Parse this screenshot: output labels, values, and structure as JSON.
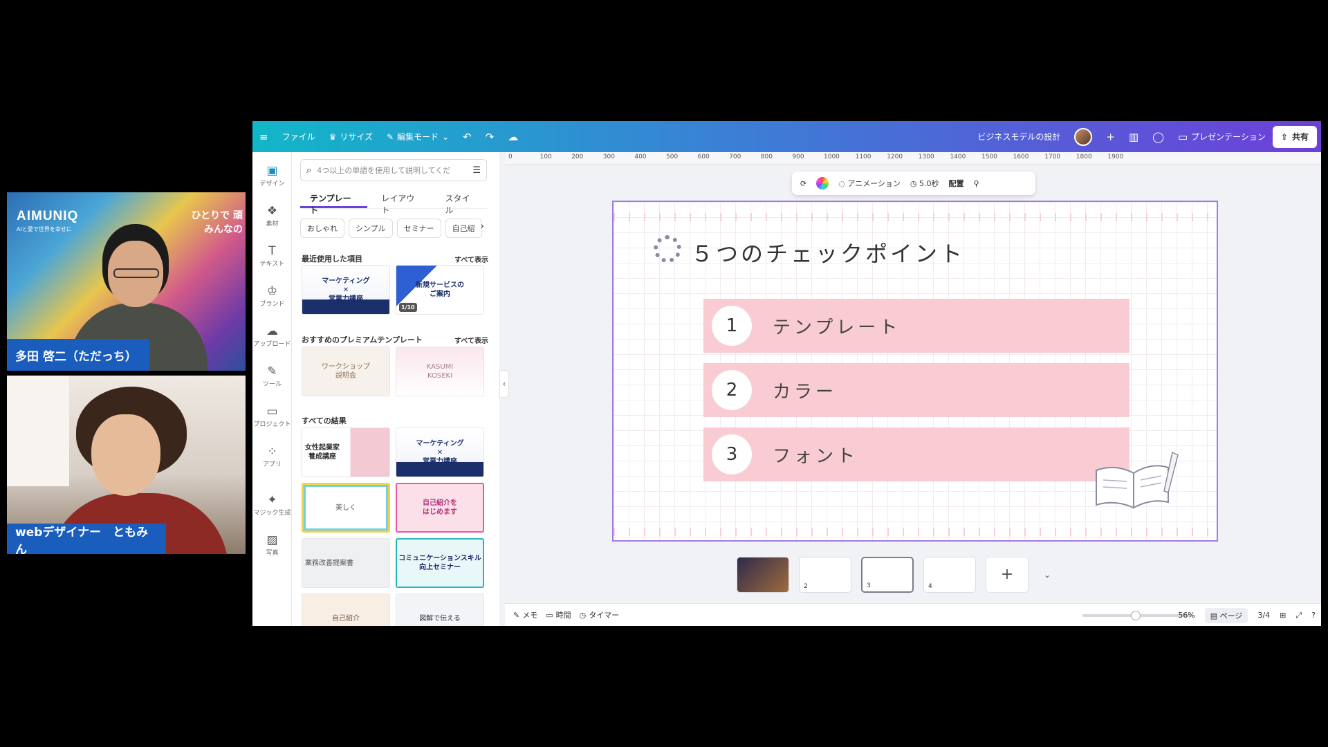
{
  "video1": {
    "logo": "AIMUNIQ",
    "logo_sub": "AIと愛で世界を幸せに",
    "banner": "ひとりで 頑\nみんなの",
    "name": "多田 啓二（ただっち）"
  },
  "video2": {
    "name": "webデザイナー　ともみん"
  },
  "topbar": {
    "menu_icon": "≡",
    "file": "ファイル",
    "resize": "リサイズ",
    "edit_mode": "編集モード",
    "undo": "↶",
    "redo": "↷",
    "cloud": "☁",
    "doc_title": "ビジネスモデルの設計",
    "plus": "+",
    "present": "プレゼンテーション",
    "share": "共有"
  },
  "rail": [
    {
      "icon": "▣",
      "label": "デザイン"
    },
    {
      "icon": "❖",
      "label": "素材"
    },
    {
      "icon": "T",
      "label": "テキスト"
    },
    {
      "icon": "♔",
      "label": "ブランド"
    },
    {
      "icon": "☁",
      "label": "アップロード"
    },
    {
      "icon": "✎",
      "label": "ツール"
    },
    {
      "icon": "▭",
      "label": "プロジェクト"
    },
    {
      "icon": "⁘",
      "label": "アプリ"
    },
    {
      "icon": "✦",
      "label": "マジック生成"
    },
    {
      "icon": "▨",
      "label": "写真"
    }
  ],
  "panel": {
    "search_placeholder": "4つ以上の単語を使用して説明してくだ",
    "tabs": [
      "テンプレート",
      "レイアウト",
      "スタイル"
    ],
    "chips": [
      "おしゃれ",
      "シンプル",
      "セミナー",
      "自己紹"
    ],
    "recent_title": "最近使用した項目",
    "see_all": "すべて表示",
    "premium_title": "おすすめのプレミアムテンプレート",
    "results_title": "すべての結果",
    "thumbs": {
      "mkt": "マーケティング\n✕\n営業力講座",
      "new": "新規サービスの\nご案内",
      "new_count": "1/10",
      "ws": "ワークショップ\n説明会",
      "kas": "KASUMI\nKOSEKI",
      "wom": "女性起業家\n養成講座",
      "mkt2": "マーケティング\n✕\n営業力講座",
      "beauty": "美しく",
      "pink": "自己紹介を\nはじめます",
      "gray": "業務改善提案書",
      "comm": "コミュニケーションスキル\n向上セミナー",
      "self": "自己紹介",
      "fig": "図解で伝える"
    }
  },
  "ruler": [
    "0",
    "100",
    "200",
    "300",
    "400",
    "500",
    "600",
    "700",
    "800",
    "900",
    "1000",
    "1100",
    "1200",
    "1300",
    "1400",
    "1500",
    "1600",
    "1700",
    "1800",
    "1900"
  ],
  "float_toolbar": {
    "animation": "アニメーション",
    "duration": "5.0秒",
    "arrange": "配置"
  },
  "slide": {
    "title": "５つのチェックポイント",
    "items": [
      {
        "num": "1",
        "label": "テンプレート"
      },
      {
        "num": "2",
        "label": "カラー"
      },
      {
        "num": "3",
        "label": "フォント"
      }
    ]
  },
  "pages": [
    "",
    "2",
    "3",
    "4"
  ],
  "bottombar": {
    "memo": "メモ",
    "time": "時間",
    "timer": "タイマー",
    "zoom": "56%",
    "page_label": "ページ",
    "page_count": "3/4"
  },
  "colors": {
    "accent": "#6d3fd8",
    "topbar_start": "#12b6c8",
    "item_fill": "#f9ccd3",
    "name_tag": "#1a5dbd"
  }
}
